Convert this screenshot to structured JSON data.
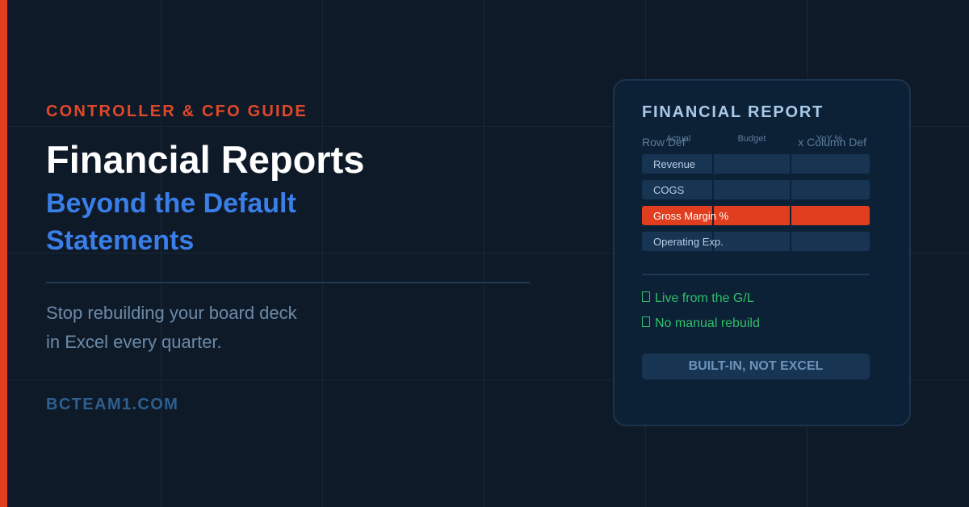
{
  "hero": {
    "eyebrow": "CONTROLLER & CFO GUIDE",
    "title": "Financial Reports",
    "subtitle_line1": "Beyond the Default",
    "subtitle_line2": "Statements",
    "description_line1": "Stop rebuilding your board deck",
    "description_line2": "in Excel every quarter.",
    "website": "BCTEAM1.COM"
  },
  "card": {
    "title": "FINANCIAL REPORT",
    "row_def_label": "Row Def",
    "column_def_label": "x Column Def",
    "columns": [
      "Actual",
      "Budget",
      "YoY %"
    ],
    "rows": [
      "Revenue",
      "COGS",
      "Gross Margin %",
      "Operating Exp."
    ],
    "highlighted_row": "Gross Margin %",
    "features": [
      "Live from the G/L",
      "No manual rebuild"
    ],
    "cta": "BUILT-IN, NOT EXCEL"
  },
  "colors": {
    "background": "#0f1a28",
    "accent": "#e03e1e",
    "brand_blue": "#3a7ee8",
    "success_green": "#2fbf6a"
  }
}
